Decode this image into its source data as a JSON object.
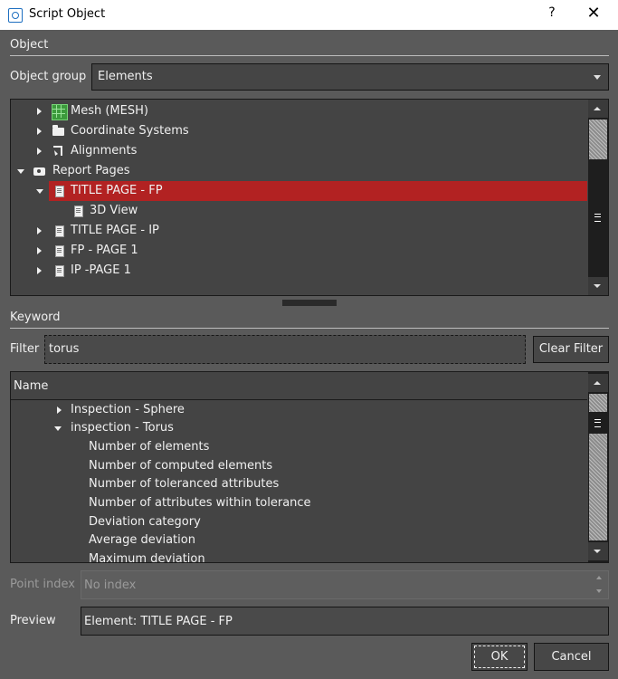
{
  "window": {
    "title": "Script Object",
    "help_glyph": "?",
    "close_glyph": "✕"
  },
  "object_section": {
    "label": "Object",
    "object_group_label": "Object group",
    "object_group_value": "Elements",
    "tree": [
      {
        "label": "Mesh (MESH)",
        "icon": "mesh-icon",
        "expanded": false
      },
      {
        "label": "Coordinate Systems",
        "icon": "folder-icon",
        "expanded": false
      },
      {
        "label": "Alignments",
        "icon": "alignment-icon",
        "expanded": false
      },
      {
        "label": "Report Pages",
        "icon": "camera-icon",
        "expanded": true
      },
      {
        "label": "TITLE PAGE - FP",
        "icon": "page-icon",
        "expanded": true,
        "selected": true
      },
      {
        "label": "3D View",
        "icon": "page-icon"
      },
      {
        "label": "TITLE PAGE - IP",
        "icon": "page-icon",
        "expanded": false
      },
      {
        "label": "FP - PAGE 1",
        "icon": "page-icon",
        "expanded": false
      },
      {
        "label": "IP -PAGE 1",
        "icon": "page-icon",
        "expanded": false
      }
    ]
  },
  "keyword_section": {
    "label": "Keyword",
    "filter_label": "Filter",
    "filter_value": "torus",
    "clear_filter_label": "Clear Filter",
    "list_header": "Name",
    "list": [
      {
        "label": "Inspection - Sphere",
        "expanded": false
      },
      {
        "label": "inspection - Torus",
        "expanded": true
      },
      {
        "label": "Number of elements"
      },
      {
        "label": "Number of computed elements"
      },
      {
        "label": "Number of toleranced attributes"
      },
      {
        "label": "Number of attributes within tolerance"
      },
      {
        "label": "Deviation category"
      },
      {
        "label": "Average deviation"
      },
      {
        "label": "Maximum deviation"
      }
    ]
  },
  "point_index": {
    "label": "Point index",
    "value": "No index"
  },
  "preview": {
    "label": "Preview",
    "value": "Element: TITLE PAGE - FP"
  },
  "buttons": {
    "ok": "OK",
    "cancel": "Cancel"
  },
  "colors": {
    "selection": "#b22222",
    "background": "#5a5a5a",
    "panel": "#444444"
  }
}
